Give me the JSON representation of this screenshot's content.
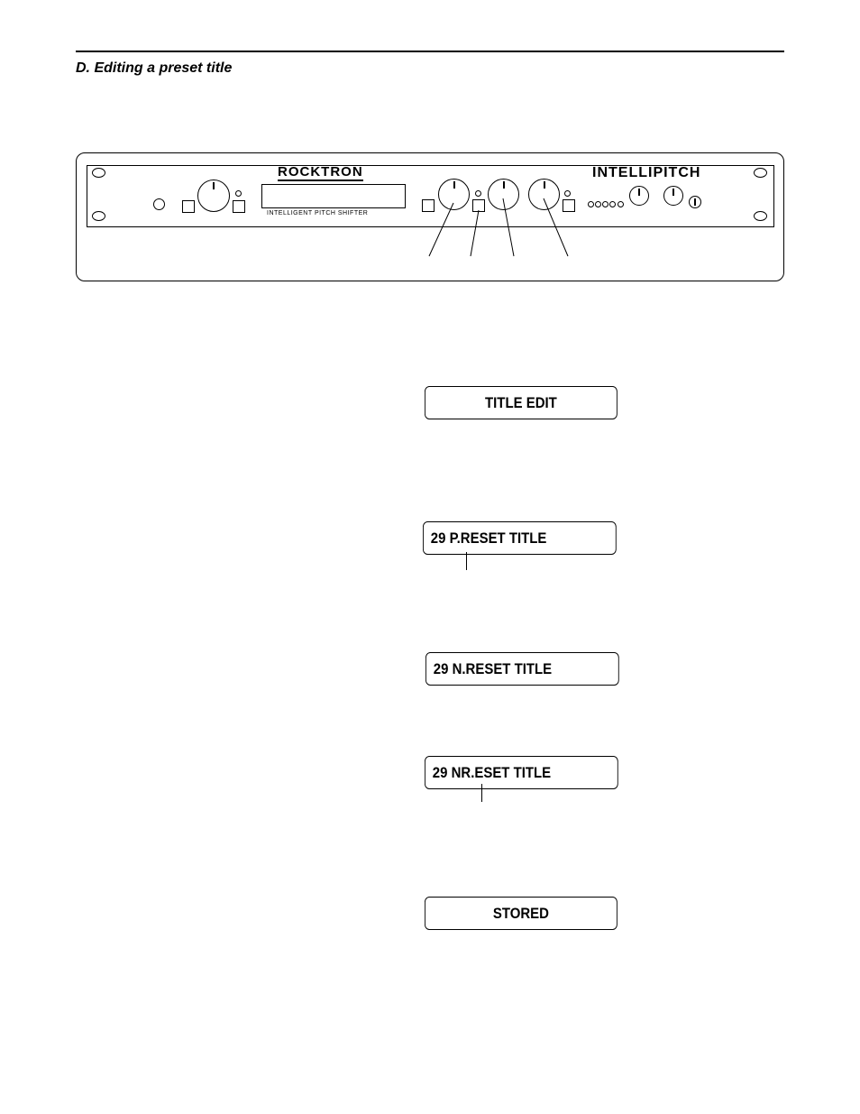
{
  "section": {
    "heading": "D. Editing a preset title"
  },
  "device": {
    "brand": "ROCKTRON",
    "subtitle": "INTELLIGENT PITCH SHIFTER",
    "product": "INTELLIPITCH"
  },
  "displays": [
    {
      "text": "TITLE EDIT"
    },
    {
      "text": "29  P.RESET TITLE"
    },
    {
      "text": "29  N.RESET TITLE"
    },
    {
      "text": "29  NR.ESET TITLE"
    },
    {
      "text": "STORED"
    }
  ]
}
